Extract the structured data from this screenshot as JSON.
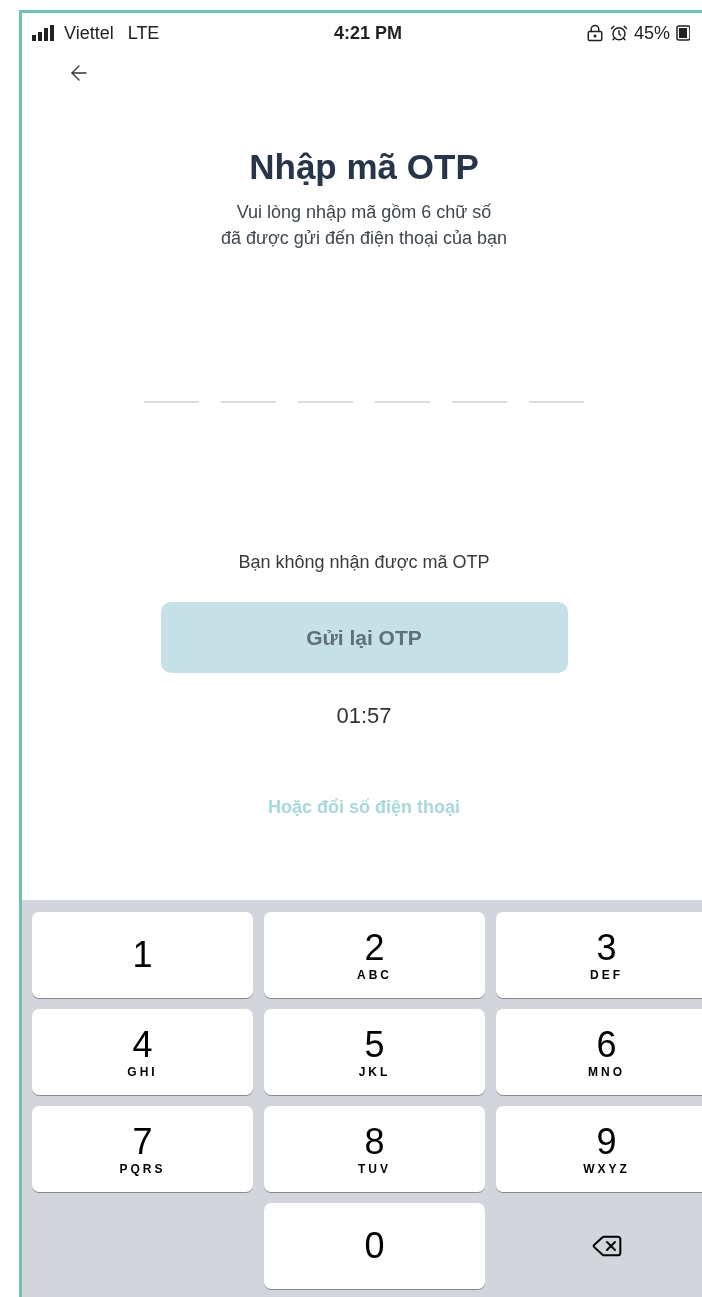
{
  "status_bar": {
    "carrier": "Viettel",
    "network": "LTE",
    "time": "4:21 PM",
    "battery": "45%"
  },
  "title": "Nhập mã OTP",
  "subtitle": [
    "Vui lòng nhập mã gồm 6 chữ số",
    "đã được gửi đến điện thoại của bạn"
  ],
  "otp_slots": [
    {
      "filled": false
    },
    {
      "filled": false
    },
    {
      "filled": false
    },
    {
      "filled": false
    },
    {
      "filled": false
    },
    {
      "filled": false
    }
  ],
  "resend_prompt": "Bạn không nhận được mã OTP",
  "resend_button": {
    "label": "Gửi lại OTP",
    "disabled": true
  },
  "countdown": "01:57",
  "change_phone_link": "Hoặc đổi số điện thoại",
  "keypad": [
    {
      "kind": "digit",
      "digit": "1"
    },
    {
      "kind": "digit",
      "digit": "2",
      "letters": "ABC"
    },
    {
      "kind": "digit",
      "digit": "3",
      "letters": "DEF"
    },
    {
      "kind": "digit",
      "digit": "4",
      "letters": "GHI"
    },
    {
      "kind": "digit",
      "digit": "5",
      "letters": "JKL"
    },
    {
      "kind": "digit",
      "digit": "6",
      "letters": "MNO"
    },
    {
      "kind": "digit",
      "digit": "7",
      "letters": "PQRS"
    },
    {
      "kind": "digit",
      "digit": "8",
      "letters": "TUV"
    },
    {
      "kind": "digit",
      "digit": "9",
      "letters": "WXYZ"
    },
    {
      "kind": "blank"
    },
    {
      "kind": "digit",
      "digit": "0"
    },
    {
      "kind": "delete"
    }
  ]
}
